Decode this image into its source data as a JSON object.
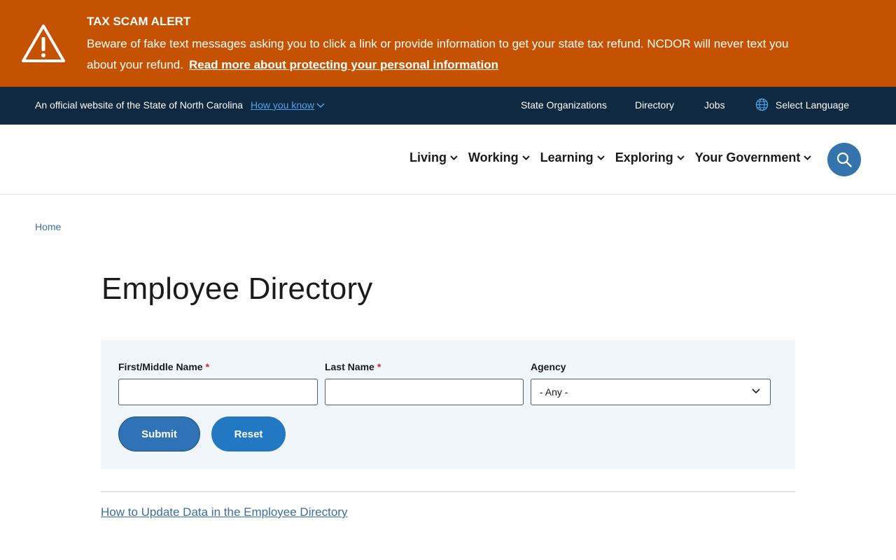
{
  "alert": {
    "title": "TAX SCAM ALERT",
    "body": "Beware of fake text messages asking you to click a link or provide information to get your state tax refund. NCDOR will never text you about your refund.",
    "link": "Read more about protecting your personal information",
    "icon": "warning-icon",
    "color": "#c55200"
  },
  "official_bar": {
    "text": "An official website of the State of North Carolina",
    "how_you_know": "How you know",
    "links": [
      "State Organizations",
      "Directory",
      "Jobs"
    ],
    "language": "Select Language",
    "color": "#0f2940"
  },
  "nav": {
    "items": [
      "Living",
      "Working",
      "Learning",
      "Exploring",
      "Your Government"
    ],
    "search_icon": "search-icon"
  },
  "breadcrumb": {
    "home": "Home"
  },
  "page": {
    "title": "Employee Directory"
  },
  "form": {
    "first_name_label": "First/Middle Name",
    "last_name_label": "Last Name",
    "agency_label": "Agency",
    "required_mark": "*",
    "first_name_value": "",
    "last_name_value": "",
    "agency_selected": "- Any -",
    "submit_label": "Submit",
    "reset_label": "Reset"
  },
  "footer_link": "How to Update Data in the Employee Directory",
  "colors": {
    "accent": "#2378c3",
    "link": "#3d6e9e"
  }
}
